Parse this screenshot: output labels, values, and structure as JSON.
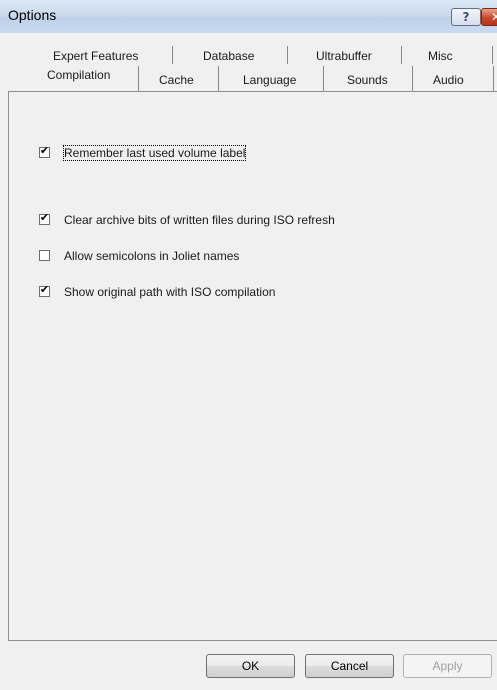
{
  "window": {
    "title": "Options",
    "help_icon": "?",
    "close_icon": "✕"
  },
  "tabs": {
    "row_back": [
      "Expert Features",
      "Database",
      "Ultrabuffer",
      "Misc"
    ],
    "row_front": [
      "Compilation",
      "Cache",
      "Language",
      "Sounds",
      "Audio"
    ],
    "selected": "Compilation"
  },
  "checkboxes": [
    {
      "label": "Remember last used volume label",
      "checked": true,
      "focused": true
    },
    {
      "label": "Clear archive bits of written files during ISO refresh",
      "checked": true
    },
    {
      "label": "Allow semicolons in Joliet names",
      "checked": false
    },
    {
      "label": "Show original path with ISO compilation",
      "checked": true
    }
  ],
  "buttons": {
    "ok": "OK",
    "cancel": "Cancel",
    "apply": "Apply",
    "apply_disabled": true
  }
}
